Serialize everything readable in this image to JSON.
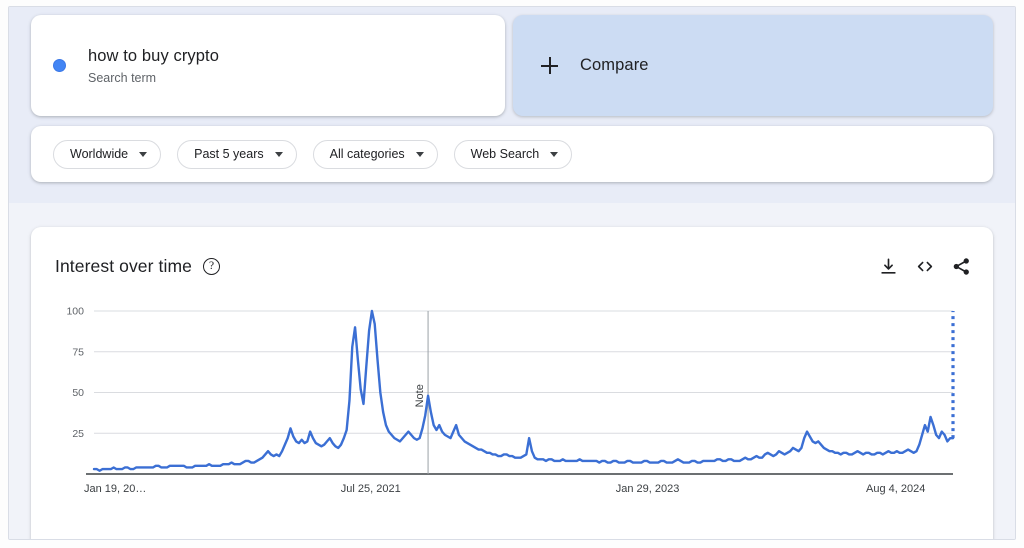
{
  "query": {
    "term": "how to buy crypto",
    "type_label": "Search term",
    "dot_color": "#4285f4"
  },
  "compare": {
    "label": "Compare",
    "icon": "plus-icon",
    "background": "#ccdcf3"
  },
  "filters": [
    {
      "label": "Worldwide"
    },
    {
      "label": "Past 5 years"
    },
    {
      "label": "All categories"
    },
    {
      "label": "Web Search"
    }
  ],
  "chart_panel": {
    "title": "Interest over time",
    "help_icon_glyph": "?",
    "actions": [
      {
        "name": "download-icon",
        "title": "Download"
      },
      {
        "name": "embed-code-icon",
        "title": "Embed"
      },
      {
        "name": "share-icon",
        "title": "Share"
      }
    ]
  },
  "chart_data": {
    "type": "line",
    "title": "Interest over time",
    "xlabel": "",
    "ylabel": "",
    "ylim": [
      0,
      100
    ],
    "yticks": [
      25,
      50,
      75,
      100
    ],
    "grid": true,
    "legend": false,
    "line_color": "#3b6fd4",
    "series_name": "how to buy crypto",
    "xtick_labels": [
      "Jan 19, 20…",
      "Jul 25, 2021",
      "Jan 29, 2023",
      "Aug 4, 2024"
    ],
    "xtick_positions": [
      0,
      0.3222,
      0.6444,
      0.9333
    ],
    "annotations": [
      {
        "label": "Note",
        "x_fraction": 0.3889,
        "orientation": "vertical"
      }
    ],
    "partial_data": {
      "style": "dotted",
      "x_fraction": 1.0,
      "from_value": 22,
      "to_value": 100
    },
    "values": [
      3,
      3,
      2,
      3,
      3,
      3,
      3,
      4,
      3,
      3,
      3,
      4,
      4,
      3,
      3,
      4,
      4,
      4,
      4,
      4,
      4,
      4,
      5,
      5,
      4,
      4,
      4,
      5,
      5,
      5,
      5,
      5,
      5,
      4,
      4,
      4,
      5,
      5,
      5,
      5,
      5,
      6,
      5,
      5,
      5,
      5,
      6,
      6,
      6,
      7,
      6,
      6,
      6,
      7,
      8,
      8,
      7,
      7,
      8,
      9,
      10,
      12,
      14,
      12,
      11,
      12,
      11,
      14,
      18,
      22,
      28,
      23,
      20,
      19,
      21,
      19,
      20,
      26,
      22,
      19,
      18,
      17,
      18,
      20,
      22,
      19,
      17,
      16,
      18,
      22,
      27,
      45,
      78,
      90,
      70,
      52,
      43,
      66,
      88,
      100,
      92,
      70,
      50,
      38,
      30,
      26,
      24,
      22,
      21,
      20,
      22,
      24,
      26,
      24,
      22,
      21,
      22,
      28,
      36,
      48,
      38,
      30,
      27,
      30,
      26,
      24,
      23,
      22,
      26,
      30,
      24,
      22,
      20,
      19,
      18,
      17,
      16,
      15,
      15,
      14,
      13,
      13,
      12,
      12,
      11,
      11,
      12,
      12,
      11,
      11,
      10,
      10,
      10,
      11,
      12,
      22,
      14,
      10,
      9,
      9,
      9,
      8,
      9,
      9,
      8,
      8,
      8,
      9,
      8,
      8,
      8,
      8,
      8,
      9,
      8,
      8,
      8,
      8,
      8,
      8,
      7,
      8,
      8,
      7,
      7,
      8,
      8,
      7,
      7,
      7,
      8,
      8,
      7,
      7,
      7,
      7,
      8,
      8,
      7,
      7,
      7,
      7,
      8,
      8,
      7,
      7,
      7,
      8,
      9,
      8,
      7,
      7,
      7,
      8,
      8,
      7,
      7,
      8,
      8,
      8,
      8,
      8,
      9,
      9,
      8,
      8,
      9,
      9,
      8,
      8,
      8,
      9,
      10,
      9,
      9,
      10,
      11,
      10,
      10,
      12,
      13,
      12,
      11,
      12,
      14,
      13,
      12,
      13,
      14,
      16,
      15,
      14,
      16,
      22,
      26,
      23,
      20,
      19,
      20,
      18,
      16,
      15,
      14,
      14,
      13,
      13,
      12,
      13,
      13,
      12,
      12,
      13,
      14,
      13,
      12,
      13,
      13,
      12,
      12,
      13,
      13,
      12,
      13,
      14,
      13,
      13,
      14,
      13,
      13,
      14,
      15,
      14,
      13,
      14,
      18,
      24,
      30,
      26,
      35,
      30,
      24,
      22,
      26,
      24,
      20,
      22,
      22
    ]
  }
}
